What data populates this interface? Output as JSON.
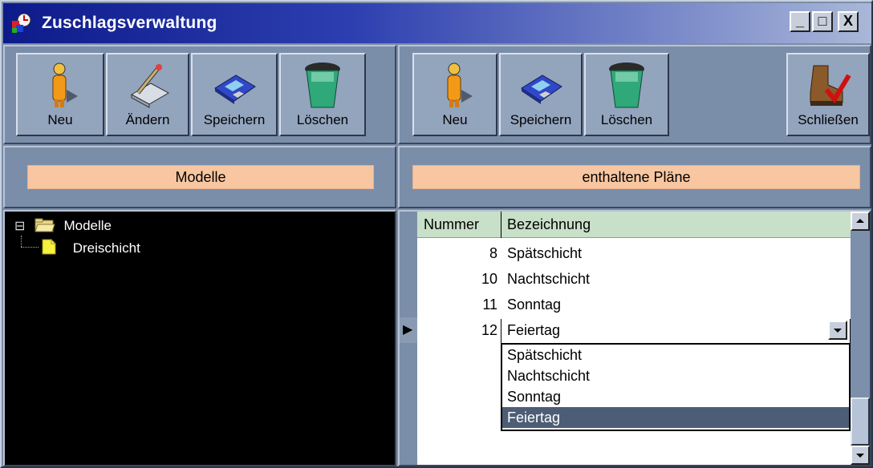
{
  "window": {
    "title": "Zuschlagsverwaltung",
    "controls": {
      "minimize": "_",
      "maximize": "□",
      "close": "X"
    }
  },
  "left_toolbar": {
    "buttons": [
      {
        "label": "Neu",
        "icon": "person-new-icon"
      },
      {
        "label": "Ändern",
        "icon": "edit-pen-icon"
      },
      {
        "label": "Speichern",
        "icon": "floppy-disk-icon"
      },
      {
        "label": "Löschen",
        "icon": "trash-bin-icon"
      }
    ]
  },
  "right_toolbar": {
    "buttons": [
      {
        "label": "Neu",
        "icon": "person-new-icon"
      },
      {
        "label": "Speichern",
        "icon": "floppy-disk-icon"
      },
      {
        "label": "Löschen",
        "icon": "trash-bin-icon"
      },
      {
        "label": "Schließen",
        "icon": "boot-check-icon"
      }
    ]
  },
  "left_panel": {
    "header": "Modelle",
    "tree": {
      "root": {
        "label": "Modelle",
        "expand_glyph": "⊟"
      },
      "children": [
        {
          "label": "Dreischicht"
        }
      ]
    }
  },
  "right_panel": {
    "header": "enthaltene Pläne",
    "grid": {
      "columns": [
        "Nummer",
        "Bezeichnung"
      ],
      "rows": [
        {
          "nummer": "8",
          "bezeichnung": "Spätschicht"
        },
        {
          "nummer": "10",
          "bezeichnung": "Nachtschicht"
        },
        {
          "nummer": "11",
          "bezeichnung": "Sonntag"
        },
        {
          "nummer": "12",
          "bezeichnung": "Feiertag"
        }
      ],
      "current_row_indicator": "▶"
    },
    "dropdown": {
      "options": [
        "Spätschicht",
        "Nachtschicht",
        "Sonntag",
        "Feiertag"
      ],
      "selected": "Feiertag"
    }
  },
  "colors": {
    "title_gradient_start": "#0d1a8a",
    "header_bar": "#f8c7a2",
    "grid_header": "#c8dfc8",
    "selection": "#4d5d75"
  }
}
